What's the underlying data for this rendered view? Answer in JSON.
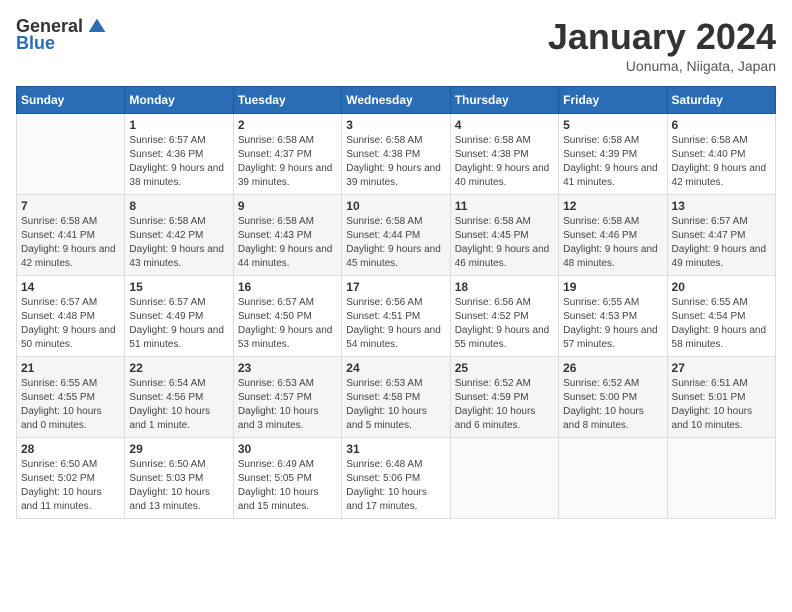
{
  "header": {
    "logo_general": "General",
    "logo_blue": "Blue",
    "title": "January 2024",
    "location": "Uonuma, Niigata, Japan"
  },
  "weekdays": [
    "Sunday",
    "Monday",
    "Tuesday",
    "Wednesday",
    "Thursday",
    "Friday",
    "Saturday"
  ],
  "weeks": [
    [
      {
        "day": "",
        "sunrise": "",
        "sunset": "",
        "daylight": ""
      },
      {
        "day": "1",
        "sunrise": "Sunrise: 6:57 AM",
        "sunset": "Sunset: 4:36 PM",
        "daylight": "Daylight: 9 hours and 38 minutes."
      },
      {
        "day": "2",
        "sunrise": "Sunrise: 6:58 AM",
        "sunset": "Sunset: 4:37 PM",
        "daylight": "Daylight: 9 hours and 39 minutes."
      },
      {
        "day": "3",
        "sunrise": "Sunrise: 6:58 AM",
        "sunset": "Sunset: 4:38 PM",
        "daylight": "Daylight: 9 hours and 39 minutes."
      },
      {
        "day": "4",
        "sunrise": "Sunrise: 6:58 AM",
        "sunset": "Sunset: 4:38 PM",
        "daylight": "Daylight: 9 hours and 40 minutes."
      },
      {
        "day": "5",
        "sunrise": "Sunrise: 6:58 AM",
        "sunset": "Sunset: 4:39 PM",
        "daylight": "Daylight: 9 hours and 41 minutes."
      },
      {
        "day": "6",
        "sunrise": "Sunrise: 6:58 AM",
        "sunset": "Sunset: 4:40 PM",
        "daylight": "Daylight: 9 hours and 42 minutes."
      }
    ],
    [
      {
        "day": "7",
        "sunrise": "Sunrise: 6:58 AM",
        "sunset": "Sunset: 4:41 PM",
        "daylight": "Daylight: 9 hours and 42 minutes."
      },
      {
        "day": "8",
        "sunrise": "Sunrise: 6:58 AM",
        "sunset": "Sunset: 4:42 PM",
        "daylight": "Daylight: 9 hours and 43 minutes."
      },
      {
        "day": "9",
        "sunrise": "Sunrise: 6:58 AM",
        "sunset": "Sunset: 4:43 PM",
        "daylight": "Daylight: 9 hours and 44 minutes."
      },
      {
        "day": "10",
        "sunrise": "Sunrise: 6:58 AM",
        "sunset": "Sunset: 4:44 PM",
        "daylight": "Daylight: 9 hours and 45 minutes."
      },
      {
        "day": "11",
        "sunrise": "Sunrise: 6:58 AM",
        "sunset": "Sunset: 4:45 PM",
        "daylight": "Daylight: 9 hours and 46 minutes."
      },
      {
        "day": "12",
        "sunrise": "Sunrise: 6:58 AM",
        "sunset": "Sunset: 4:46 PM",
        "daylight": "Daylight: 9 hours and 48 minutes."
      },
      {
        "day": "13",
        "sunrise": "Sunrise: 6:57 AM",
        "sunset": "Sunset: 4:47 PM",
        "daylight": "Daylight: 9 hours and 49 minutes."
      }
    ],
    [
      {
        "day": "14",
        "sunrise": "Sunrise: 6:57 AM",
        "sunset": "Sunset: 4:48 PM",
        "daylight": "Daylight: 9 hours and 50 minutes."
      },
      {
        "day": "15",
        "sunrise": "Sunrise: 6:57 AM",
        "sunset": "Sunset: 4:49 PM",
        "daylight": "Daylight: 9 hours and 51 minutes."
      },
      {
        "day": "16",
        "sunrise": "Sunrise: 6:57 AM",
        "sunset": "Sunset: 4:50 PM",
        "daylight": "Daylight: 9 hours and 53 minutes."
      },
      {
        "day": "17",
        "sunrise": "Sunrise: 6:56 AM",
        "sunset": "Sunset: 4:51 PM",
        "daylight": "Daylight: 9 hours and 54 minutes."
      },
      {
        "day": "18",
        "sunrise": "Sunrise: 6:56 AM",
        "sunset": "Sunset: 4:52 PM",
        "daylight": "Daylight: 9 hours and 55 minutes."
      },
      {
        "day": "19",
        "sunrise": "Sunrise: 6:55 AM",
        "sunset": "Sunset: 4:53 PM",
        "daylight": "Daylight: 9 hours and 57 minutes."
      },
      {
        "day": "20",
        "sunrise": "Sunrise: 6:55 AM",
        "sunset": "Sunset: 4:54 PM",
        "daylight": "Daylight: 9 hours and 58 minutes."
      }
    ],
    [
      {
        "day": "21",
        "sunrise": "Sunrise: 6:55 AM",
        "sunset": "Sunset: 4:55 PM",
        "daylight": "Daylight: 10 hours and 0 minutes."
      },
      {
        "day": "22",
        "sunrise": "Sunrise: 6:54 AM",
        "sunset": "Sunset: 4:56 PM",
        "daylight": "Daylight: 10 hours and 1 minute."
      },
      {
        "day": "23",
        "sunrise": "Sunrise: 6:53 AM",
        "sunset": "Sunset: 4:57 PM",
        "daylight": "Daylight: 10 hours and 3 minutes."
      },
      {
        "day": "24",
        "sunrise": "Sunrise: 6:53 AM",
        "sunset": "Sunset: 4:58 PM",
        "daylight": "Daylight: 10 hours and 5 minutes."
      },
      {
        "day": "25",
        "sunrise": "Sunrise: 6:52 AM",
        "sunset": "Sunset: 4:59 PM",
        "daylight": "Daylight: 10 hours and 6 minutes."
      },
      {
        "day": "26",
        "sunrise": "Sunrise: 6:52 AM",
        "sunset": "Sunset: 5:00 PM",
        "daylight": "Daylight: 10 hours and 8 minutes."
      },
      {
        "day": "27",
        "sunrise": "Sunrise: 6:51 AM",
        "sunset": "Sunset: 5:01 PM",
        "daylight": "Daylight: 10 hours and 10 minutes."
      }
    ],
    [
      {
        "day": "28",
        "sunrise": "Sunrise: 6:50 AM",
        "sunset": "Sunset: 5:02 PM",
        "daylight": "Daylight: 10 hours and 11 minutes."
      },
      {
        "day": "29",
        "sunrise": "Sunrise: 6:50 AM",
        "sunset": "Sunset: 5:03 PM",
        "daylight": "Daylight: 10 hours and 13 minutes."
      },
      {
        "day": "30",
        "sunrise": "Sunrise: 6:49 AM",
        "sunset": "Sunset: 5:05 PM",
        "daylight": "Daylight: 10 hours and 15 minutes."
      },
      {
        "day": "31",
        "sunrise": "Sunrise: 6:48 AM",
        "sunset": "Sunset: 5:06 PM",
        "daylight": "Daylight: 10 hours and 17 minutes."
      },
      {
        "day": "",
        "sunrise": "",
        "sunset": "",
        "daylight": ""
      },
      {
        "day": "",
        "sunrise": "",
        "sunset": "",
        "daylight": ""
      },
      {
        "day": "",
        "sunrise": "",
        "sunset": "",
        "daylight": ""
      }
    ]
  ]
}
